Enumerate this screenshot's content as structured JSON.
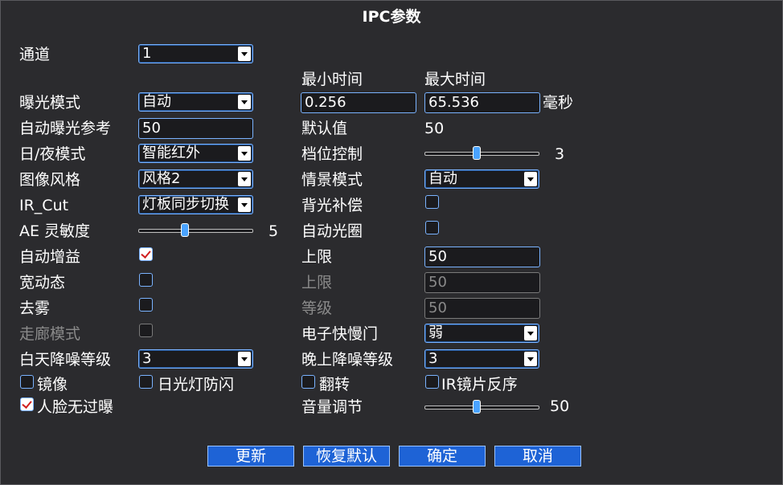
{
  "title": "IPC参数",
  "left": {
    "channel_label": "通道",
    "channel_value": "1",
    "exposure_mode_label": "曝光模式",
    "exposure_mode_value": "自动",
    "auto_exposure_ref_label": "自动曝光参考",
    "auto_exposure_ref_value": "50",
    "day_night_label": "日/夜模式",
    "day_night_value": "智能红外",
    "image_style_label": "图像风格",
    "image_style_value": "风格2",
    "ir_cut_label": "IR_Cut",
    "ir_cut_value": "灯板同步切换",
    "ae_sensitivity_label": "AE 灵敏度",
    "ae_sensitivity_value": "5",
    "ae_sensitivity_level": 0.4,
    "auto_gain_label": "自动增益",
    "auto_gain_checked": true,
    "wdr_label": "宽动态",
    "wdr_checked": false,
    "defog_label": "去雾",
    "defog_checked": false,
    "corridor_label": "走廊模式",
    "corridor_checked": false,
    "day_nr_label": "白天降噪等级",
    "day_nr_value": "3",
    "mirror_label": "镜像",
    "mirror_checked": false,
    "flicker_label": "日光灯防闪",
    "flicker_checked": false,
    "face_label": "人脸无过曝",
    "face_checked": true
  },
  "right": {
    "min_time_label": "最小时间",
    "max_time_label": "最大时间",
    "min_time_value": "0.256",
    "max_time_value": "65.536",
    "unit_label": "毫秒",
    "default_label": "默认值",
    "default_value": "50",
    "gear_label": "档位控制",
    "gear_value": "3",
    "gear_level": 0.45,
    "scene_label": "情景模式",
    "scene_value": "自动",
    "backlight_label": "背光补偿",
    "backlight_checked": false,
    "auto_iris_label": "自动光圈",
    "auto_iris_checked": false,
    "gain_upper_label": "上限",
    "gain_upper_value": "50",
    "wdr_upper_label": "上限",
    "wdr_upper_value": "50",
    "defog_level_label": "等级",
    "defog_level_value": "50",
    "shutter_label": "电子快慢门",
    "shutter_value": "弱",
    "night_nr_label": "晚上降噪等级",
    "night_nr_value": "3",
    "flip_label": "翻转",
    "flip_checked": false,
    "ir_lens_label": "IR镜片反序",
    "ir_lens_checked": false,
    "volume_label": "音量调节",
    "volume_value": "50",
    "volume_level": 0.45
  },
  "buttons": {
    "refresh": "更新",
    "restore": "恢复默认",
    "ok": "确定",
    "cancel": "取消"
  }
}
